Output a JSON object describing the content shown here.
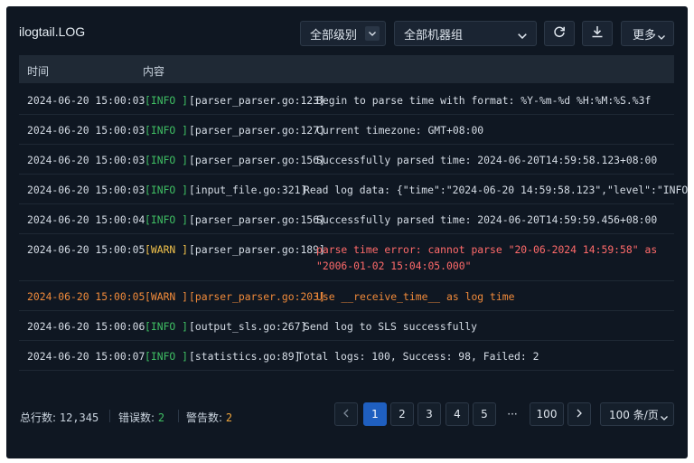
{
  "app": {
    "title": "ilogtail.LOG"
  },
  "toolbar": {
    "level_select": {
      "value": "全部级别",
      "icon": "chevron-down-icon"
    },
    "group_select": {
      "value": "全部机器组",
      "icon": "chevron-down-icon"
    },
    "refresh_icon": "refresh-icon",
    "download_icon": "download-icon",
    "more_label": "更多"
  },
  "table": {
    "columns": [
      "时间",
      "内容"
    ],
    "rows": [
      {
        "time": "2024-06-20 15:00:03",
        "level": "[INFO ]",
        "source": "[parser_parser.go:123]",
        "message": "Begin to parse time with format: %Y-%m-%d %H:%M:%S.%3f"
      },
      {
        "time": "2024-06-20 15:00:03",
        "level": "[INFO ]",
        "source": "[parser_parser.go:127]",
        "message": "Current timezone: GMT+08:00"
      },
      {
        "time": "2024-06-20 15:00:03",
        "level": "[INFO ]",
        "source": "[parser_parser.go:156]",
        "message": "Successfully parsed time: 2024-06-20T14:59:58.123+08:00"
      },
      {
        "time": "2024-06-20 15:00:03",
        "level": "[INFO ]",
        "source": "[input_file.go:321]",
        "message": "Read log data: {\"time\":\"2024-06-20 14:59:58.123\",\"level\":\"INFO\"…"
      },
      {
        "time": "2024-06-20 15:00:04",
        "level": "[INFO ]",
        "source": "[parser_parser.go:156]",
        "message": "Successfully parsed time: 2024-06-20T14:59:59.456+08:00"
      },
      {
        "time": "2024-06-20 15:00:05",
        "level": "[WARN ]",
        "source": "[parser_parser.go:189]",
        "message": "parse time error: cannot parse \"20-06-2024 14:59:58\" as",
        "message_cont": "\"2006-01-02 15:04:05.000\""
      },
      {
        "time": "2024-06-20 15:00:05",
        "level": "[WARN ]",
        "source": "[parser_parser.go:203]",
        "message": "Use __receive_time__ as log time"
      },
      {
        "time": "2024-06-20 15:00:06",
        "level": "[INFO ]",
        "source": "[output_sls.go:267]",
        "message": "Send log to SLS successfully"
      },
      {
        "time": "2024-06-20 15:00:07",
        "level": "[INFO ]",
        "source": "[statistics.go:89]",
        "message": "Total logs: 100, Success: 98, Failed: 2"
      }
    ]
  },
  "footer": {
    "total_label": "总行数:",
    "total_value": "12,345",
    "error_label": "错误数:",
    "error_value": "2",
    "warn_label": "警告数:",
    "warn_value": "2"
  },
  "pagination": {
    "prev_icon": "chevron-left-icon",
    "pages": [
      "1",
      "2",
      "3",
      "4",
      "5"
    ],
    "current": "1",
    "ellipsis": "···",
    "last": "100",
    "next_icon": "chevron-right-icon",
    "page_size": "100 条/页"
  },
  "colors": {
    "background": "#0f1722",
    "info": "#3fbf63",
    "warn": "#f0c14b",
    "error": "#ff6a6a",
    "accent": "#1f5fc0"
  }
}
